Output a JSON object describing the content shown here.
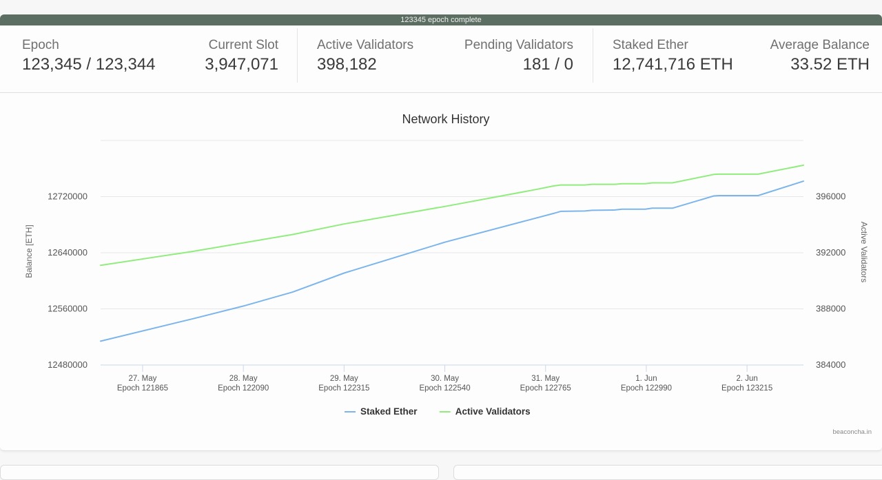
{
  "status_bar": {
    "text": "123345 epoch complete",
    "progress_percent": 100
  },
  "stats": {
    "epoch": {
      "label": "Epoch",
      "value": "123,345 / 123,344"
    },
    "current_slot": {
      "label": "Current Slot",
      "value": "3,947,071"
    },
    "active_validators": {
      "label": "Active Validators",
      "value": "398,182"
    },
    "pending_validators": {
      "label": "Pending Validators",
      "value": "181 / 0"
    },
    "staked_ether": {
      "label": "Staked Ether",
      "value": "12,741,716 ETH"
    },
    "average_balance": {
      "label": "Average Balance",
      "value": "33.52 ETH"
    }
  },
  "credits": "beaconcha.in",
  "colors": {
    "status_bar": "#5c6d61",
    "staked_ether": "#7cb5ec",
    "active_validators": "#90ed7d"
  },
  "chart_data": {
    "type": "line",
    "title": "Network History",
    "xlabel": "",
    "ylabel": "Balance [ETH]",
    "ylabel_right": "Active Validators",
    "x_unit": "days since 27. May",
    "xlim": [
      -0.417,
      6.56
    ],
    "ylim": [
      12480000,
      12800000
    ],
    "ylim_right": [
      384000,
      400000
    ],
    "grid": true,
    "legend_position": "bottom-center",
    "x_ticks": [
      {
        "x": 0,
        "date": "27. May",
        "epoch": "Epoch 121865"
      },
      {
        "x": 1,
        "date": "28. May",
        "epoch": "Epoch 122090"
      },
      {
        "x": 2,
        "date": "29. May",
        "epoch": "Epoch 122315"
      },
      {
        "x": 3,
        "date": "30. May",
        "epoch": "Epoch 122540"
      },
      {
        "x": 4,
        "date": "31. May",
        "epoch": "Epoch 122765"
      },
      {
        "x": 5,
        "date": "1. Jun",
        "epoch": "Epoch 122990"
      },
      {
        "x": 6,
        "date": "2. Jun",
        "epoch": "Epoch 123215"
      }
    ],
    "y_ticks": [
      "12480000",
      "12560000",
      "12640000",
      "12720000"
    ],
    "y_ticks_right": [
      "384000",
      "388000",
      "392000",
      "396000"
    ],
    "series": [
      {
        "name": "Staked Ether",
        "axis": "left",
        "color": "#7cb5ec",
        "points": [
          [
            -0.417,
            12514000
          ],
          [
            0.5,
            12546000
          ],
          [
            1.0,
            12564000
          ],
          [
            1.49,
            12584000
          ],
          [
            2.0,
            12611000
          ],
          [
            3.0,
            12655000
          ],
          [
            4.08,
            12696000
          ],
          [
            4.15,
            12699000
          ],
          [
            4.39,
            12699500
          ],
          [
            4.46,
            12700500
          ],
          [
            4.69,
            12701000
          ],
          [
            4.76,
            12702000
          ],
          [
            4.99,
            12702000
          ],
          [
            5.06,
            12703500
          ],
          [
            5.26,
            12703500
          ],
          [
            5.67,
            12721000
          ],
          [
            5.72,
            12721500
          ],
          [
            6.11,
            12721500
          ],
          [
            6.56,
            12742000
          ]
        ]
      },
      {
        "name": "Active Validators",
        "axis": "right",
        "color": "#90ed7d",
        "points": [
          [
            -0.417,
            391100
          ],
          [
            0.5,
            392100
          ],
          [
            1.49,
            393300
          ],
          [
            2.0,
            394050
          ],
          [
            3.0,
            395300
          ],
          [
            3.9,
            396500
          ],
          [
            4.08,
            396760
          ],
          [
            4.15,
            396830
          ],
          [
            4.39,
            396830
          ],
          [
            4.46,
            396880
          ],
          [
            4.69,
            396880
          ],
          [
            4.76,
            396920
          ],
          [
            4.99,
            396920
          ],
          [
            5.06,
            396980
          ],
          [
            5.26,
            396980
          ],
          [
            5.67,
            397580
          ],
          [
            5.72,
            397600
          ],
          [
            6.11,
            397600
          ],
          [
            6.56,
            398240
          ]
        ]
      }
    ]
  }
}
